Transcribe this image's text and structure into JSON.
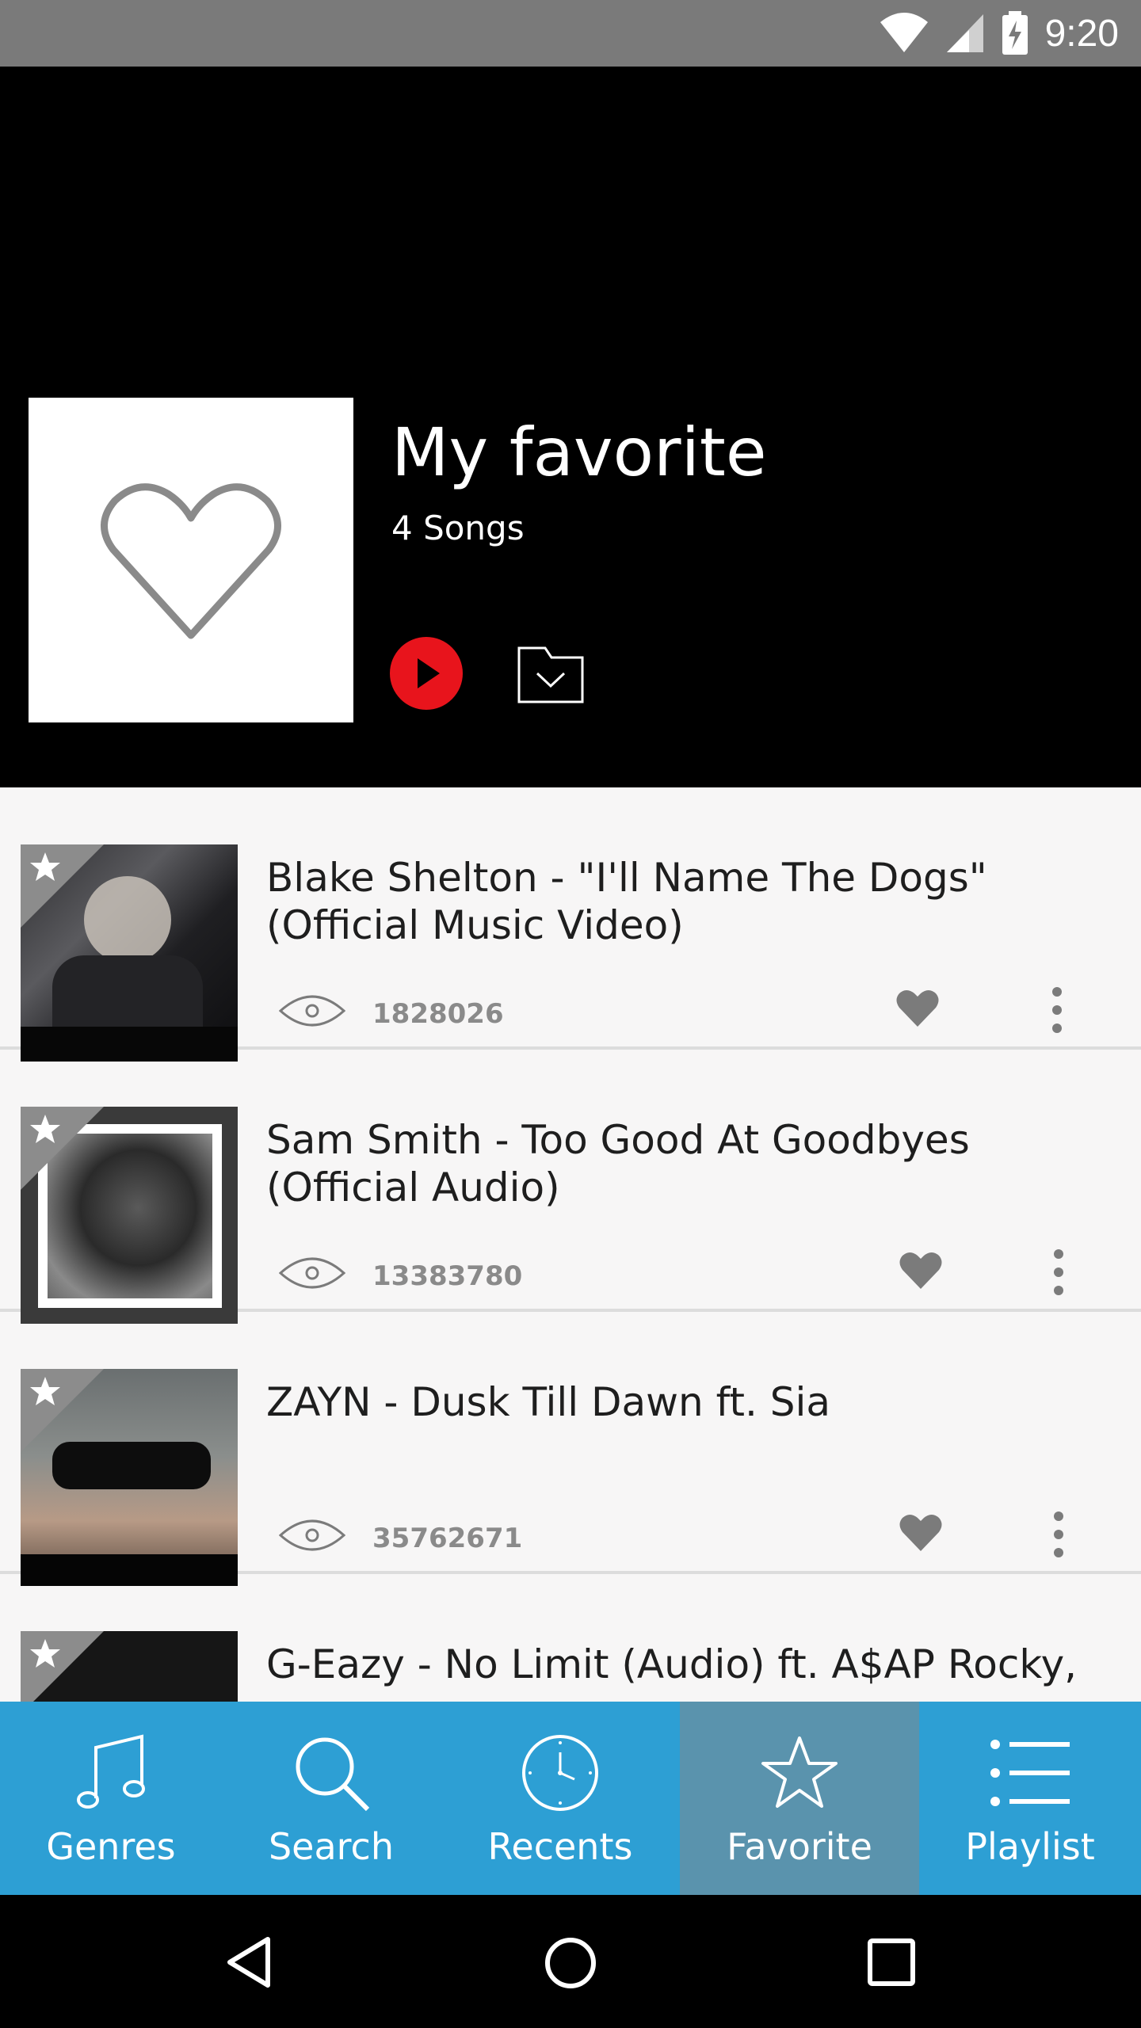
{
  "status_bar": {
    "time": "9:20"
  },
  "header": {
    "title": "My favorite",
    "subtitle": "4 Songs"
  },
  "songs": [
    {
      "title": "Blake Shelton - \"I'll Name The Dogs\" (Official Music Video)",
      "views": "1828026"
    },
    {
      "title": "Sam Smith - Too Good At Goodbyes (Official Audio)",
      "views": "13383780"
    },
    {
      "title": "ZAYN - Dusk Till Dawn ft. Sia",
      "views": "35762671"
    },
    {
      "title": "G-Eazy - No Limit (Audio) ft. A$AP Rocky,",
      "views": ""
    }
  ],
  "bottom_nav": {
    "items": [
      {
        "label": "Genres",
        "icon": "music-note-icon"
      },
      {
        "label": "Search",
        "icon": "search-icon"
      },
      {
        "label": "Recents",
        "icon": "clock-icon"
      },
      {
        "label": "Favorite",
        "icon": "star-icon",
        "active": true
      },
      {
        "label": "Playlist",
        "icon": "list-icon"
      }
    ]
  },
  "colors": {
    "header_bg": "#000000",
    "play_red": "#e8141c",
    "nav_blue": "#2d9fd4",
    "nav_active": "#5a93ad",
    "status_bar": "#7a7a7a"
  }
}
